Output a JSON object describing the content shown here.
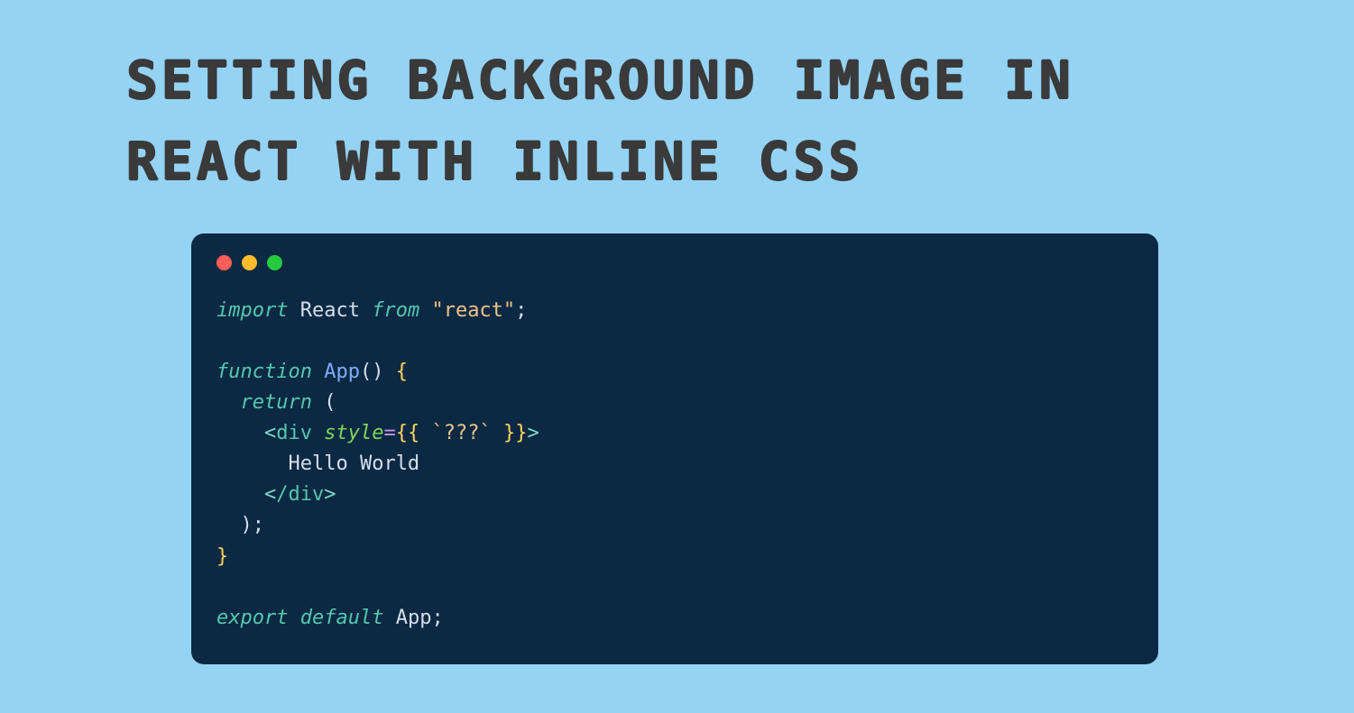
{
  "title": "SETTING BACKGROUND IMAGE IN REACT WITH INLINE CSS",
  "colors": {
    "page_bg": "#95D3F4",
    "editor_bg": "#0B2942",
    "dot_red": "#FF5F56",
    "dot_yellow": "#FFBD2E",
    "dot_green": "#27C93F"
  },
  "code": {
    "l1": {
      "kw_import": "import",
      "ident_react": "React",
      "kw_from": "from",
      "str_react": "\"react\"",
      "semi": ";"
    },
    "l2": "",
    "l3": {
      "kw_function": "function",
      "fn_name": "App",
      "parens": "()",
      "brace_open": "{"
    },
    "l4": {
      "indent": "  ",
      "kw_return": "return",
      "paren_open": "("
    },
    "l5": {
      "indent": "    ",
      "lt": "<",
      "tag": "div",
      "sp": " ",
      "attr": "style",
      "eq": "=",
      "br1": "{",
      "br2": "{",
      "sp2": " ",
      "tpl": "`???`",
      "sp3": " ",
      "br3": "}",
      "br4": "}",
      "gt": ">"
    },
    "l6": {
      "indent": "      ",
      "text": "Hello World"
    },
    "l7": {
      "indent": "    ",
      "lt": "<",
      "slash": "/",
      "tag": "div",
      "gt": ">"
    },
    "l8": {
      "indent": "  ",
      "paren_close": ")",
      "semi": ";"
    },
    "l9": {
      "brace_close": "}"
    },
    "l10": "",
    "l11": {
      "kw_export": "export",
      "kw_default": "default",
      "ident_app": "App",
      "semi": ";"
    }
  }
}
